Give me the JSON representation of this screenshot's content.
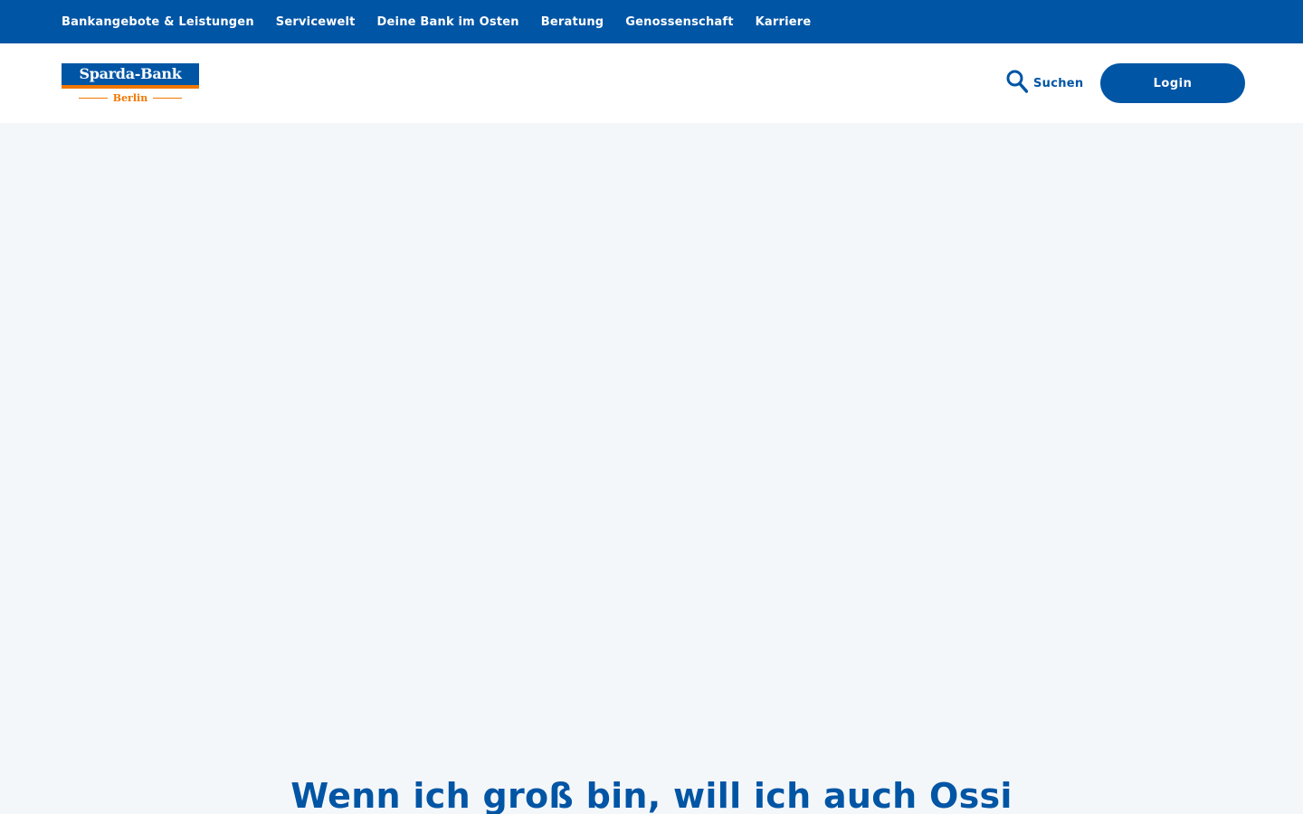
{
  "colors": {
    "brand_blue": "#0055a5",
    "brand_orange": "#f07800",
    "background": "#f4f7f9"
  },
  "top_nav": {
    "items": [
      {
        "label": "Bankangebote & Leistungen"
      },
      {
        "label": "Servicewelt"
      },
      {
        "label": "Deine Bank im Osten"
      },
      {
        "label": "Beratung"
      },
      {
        "label": "Genossenschaft"
      },
      {
        "label": "Karriere"
      }
    ]
  },
  "header": {
    "logo": {
      "name": "Sparda-Bank",
      "city": "Berlin"
    },
    "search": {
      "label": "Suchen",
      "icon": "search-icon"
    },
    "login_label": "Login"
  },
  "hero": {
    "title": "Wenn ich groß bin, will ich auch Ossi"
  }
}
